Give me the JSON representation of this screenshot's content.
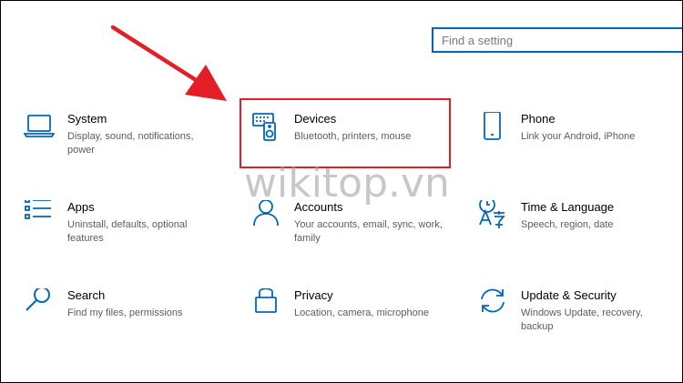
{
  "search": {
    "placeholder": "Find a setting",
    "value": ""
  },
  "accent_color": "#0067c0",
  "highlight_color": "#e31e24",
  "tiles": [
    {
      "title": "System",
      "desc": "Display, sound, notifications, power",
      "icon": "laptop-icon"
    },
    {
      "title": "Devices",
      "desc": "Bluetooth, printers, mouse",
      "icon": "devices-icon"
    },
    {
      "title": "Phone",
      "desc": "Link your Android, iPhone",
      "icon": "phone-icon"
    },
    {
      "title": "Apps",
      "desc": "Uninstall, defaults, optional features",
      "icon": "apps-list-icon"
    },
    {
      "title": "Accounts",
      "desc": "Your accounts, email, sync, work, family",
      "icon": "person-icon"
    },
    {
      "title": "Time & Language",
      "desc": "Speech, region, date",
      "icon": "time-language-icon"
    },
    {
      "title": "Search",
      "desc": "Find my files, permissions",
      "icon": "search-icon"
    },
    {
      "title": "Privacy",
      "desc": "Location, camera, microphone",
      "icon": "lock-icon"
    },
    {
      "title": "Update & Security",
      "desc": "Windows Update, recovery, backup",
      "icon": "sync-icon"
    }
  ],
  "watermark": "wikitop.vn"
}
